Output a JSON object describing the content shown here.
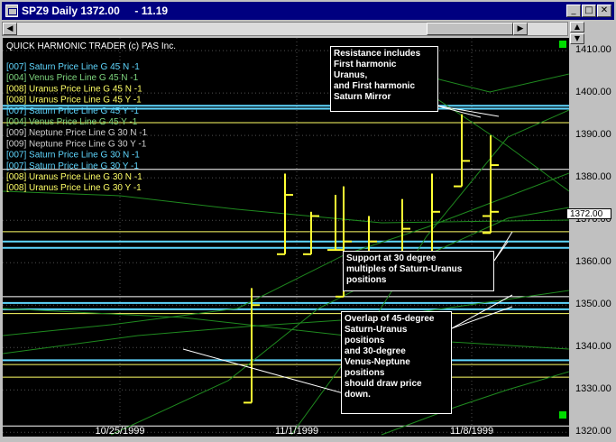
{
  "window": {
    "title": "SPZ9 Daily 1372.00     - 11.19"
  },
  "header": {
    "caption": "QUICK HARMONIC TRADER (c) PAS Inc."
  },
  "current_price": "1372.00",
  "legend": [
    {
      "label": "[007] Saturn Price Line G 45 N -1",
      "color": "#5fd7ff"
    },
    {
      "label": "[004] Venus Price Line G 45 N -1",
      "color": "#7fd77f"
    },
    {
      "label": "[008] Uranus Price Line G 45 N -1",
      "color": "#ffff66"
    },
    {
      "label": "[008] Uranus Price Line G 45 Y -1",
      "color": "#ffff66"
    },
    {
      "label": "[007] Saturn Price Line G 45 Y -1",
      "color": "#5fd7ff"
    },
    {
      "label": "[004] Venus Price Line G 45 Y -1",
      "color": "#7fd77f"
    },
    {
      "label": "[009] Neptune Price Line G 30 N -1",
      "color": "#d0d0d0"
    },
    {
      "label": "[009] Neptune Price Line G 30 Y -1",
      "color": "#d0d0d0"
    },
    {
      "label": "[007] Saturn Price Line G 30 N -1",
      "color": "#5fd7ff"
    },
    {
      "label": "[007] Saturn Price Line G 30 Y -1",
      "color": "#5fd7ff"
    },
    {
      "label": "[008] Uranus Price Line G 30 N -1",
      "color": "#ffff66"
    },
    {
      "label": "[008] Uranus Price Line G 30 Y -1",
      "color": "#ffff66"
    }
  ],
  "annotations": [
    {
      "lines": [
        "Resistance includes",
        "First harmonic",
        "Uranus,",
        "and First harmonic",
        "Saturn Mirror"
      ]
    },
    {
      "lines": [
        "Support at 30 degree",
        "multiples of Saturn-Uranus",
        "positions"
      ]
    },
    {
      "lines": [
        "Overlap of 45-degree",
        "Saturn-Uranus",
        "positions",
        "and 30-degree",
        "Venus-Neptune",
        "positions",
        "should draw price",
        "down."
      ]
    }
  ],
  "chart_data": {
    "type": "ohlc",
    "x_tick_labels": [
      "10/25/1999",
      "11/1/1999",
      "11/8/1999"
    ],
    "y_ticks": [
      1320,
      1330,
      1340,
      1350,
      1360,
      1370,
      1380,
      1390,
      1400,
      1410
    ],
    "ylim": [
      1319,
      1413
    ],
    "bars": [
      {
        "high": 1354,
        "low": 1327,
        "close": 1350
      },
      {
        "high": 1381,
        "low": 1362,
        "close": 1376
      },
      {
        "high": 1372,
        "low": 1362,
        "close": 1371
      },
      {
        "high": 1376,
        "low": 1363,
        "close": 1363
      },
      {
        "high": 1378,
        "low": 1352,
        "close": 1365
      },
      {
        "high": 1371,
        "low": 1355,
        "close": 1365
      },
      {
        "high": 1375,
        "low": 1362,
        "close": 1368
      },
      {
        "high": 1381,
        "low": 1362,
        "close": 1372
      },
      {
        "high": 1395,
        "low": 1378,
        "close": 1384
      },
      {
        "high": 1388,
        "low": 1371,
        "close": 1383
      },
      {
        "high": 1390,
        "low": 1367,
        "close": 1372
      }
    ],
    "harmonic_lines": [
      {
        "price": 1397.0,
        "color": "#5fd7ff"
      },
      {
        "price": 1396.3,
        "color": "#5fd7ff"
      },
      {
        "price": 1393.0,
        "color": "#ffff66"
      },
      {
        "price": 1382.0,
        "color": "#ffffff"
      },
      {
        "price": 1367.3,
        "color": "#ffff66"
      },
      {
        "price": 1365.0,
        "color": "#5fd7ff"
      },
      {
        "price": 1363.5,
        "color": "#5fd7ff"
      },
      {
        "price": 1352.0,
        "color": "#ffffff"
      },
      {
        "price": 1350.5,
        "color": "#5fd7ff"
      },
      {
        "price": 1349.0,
        "color": "#5fd7ff"
      },
      {
        "price": 1348.0,
        "color": "#ffff66"
      },
      {
        "price": 1337.0,
        "color": "#5fd7ff"
      },
      {
        "price": 1336.0,
        "color": "#ffff66"
      },
      {
        "price": 1333.0,
        "color": "#ffff66"
      },
      {
        "price": 1321.5,
        "color": "#ffffff"
      }
    ]
  }
}
